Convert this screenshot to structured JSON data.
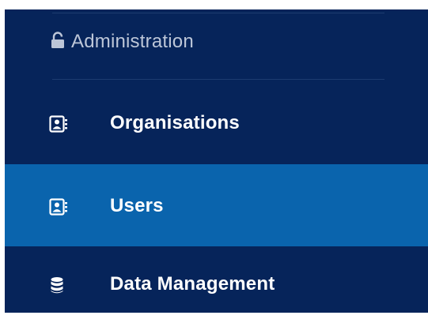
{
  "sidebar": {
    "section": {
      "label": "Administration",
      "icon": "lock-icon"
    },
    "items": [
      {
        "label": "Organisations",
        "icon": "contact-card-icon",
        "active": false
      },
      {
        "label": "Users",
        "icon": "contact-card-icon",
        "active": true
      },
      {
        "label": "Data Management",
        "icon": "database-icon",
        "active": false
      }
    ]
  },
  "colors": {
    "sidebar_bg": "#06245a",
    "active_bg": "#0a64ad",
    "section_text": "#bcc6d8",
    "item_text": "#ffffff"
  }
}
